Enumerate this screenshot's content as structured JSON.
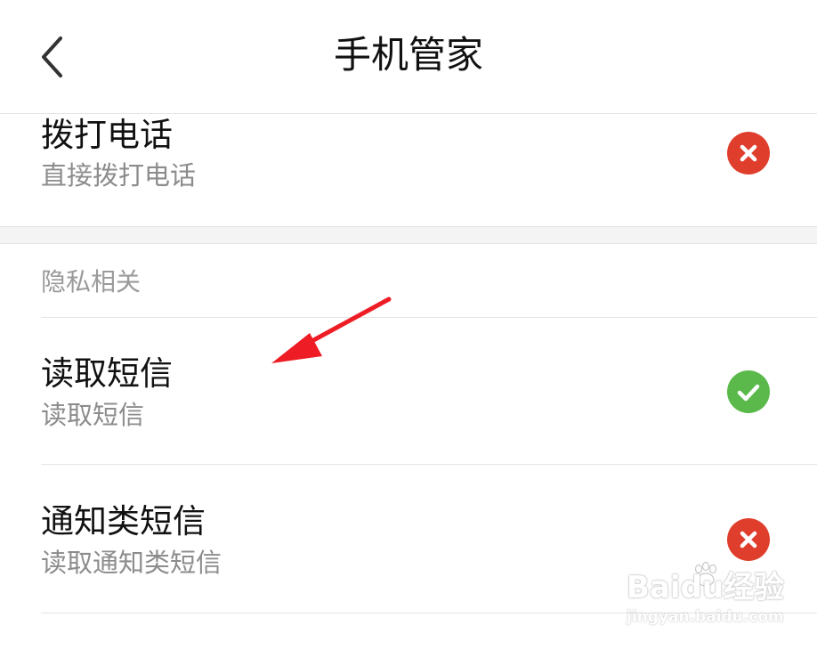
{
  "header": {
    "title": "手机管家",
    "back_icon": "chevron-left-icon"
  },
  "permissions_top": [
    {
      "title": "拨打电话",
      "subtitle": "直接拨打电话",
      "status": "denied",
      "status_icon": "close-icon"
    }
  ],
  "section": {
    "label": "隐私相关",
    "items": [
      {
        "title": "读取短信",
        "subtitle": "读取短信",
        "status": "allowed",
        "status_icon": "check-icon"
      },
      {
        "title": "通知类短信",
        "subtitle": "读取通知类短信",
        "status": "denied",
        "status_icon": "close-icon"
      }
    ]
  },
  "annotation": {
    "arrow_color": "#ee1c24"
  },
  "watermark": {
    "main": "Baidu经验",
    "sub": "jingyan.baidu.com"
  },
  "colors": {
    "denied": "#e03e2d",
    "allowed": "#5ab94a",
    "section_gap": "#f4f4f4",
    "subtitle": "#8c8c8c"
  }
}
